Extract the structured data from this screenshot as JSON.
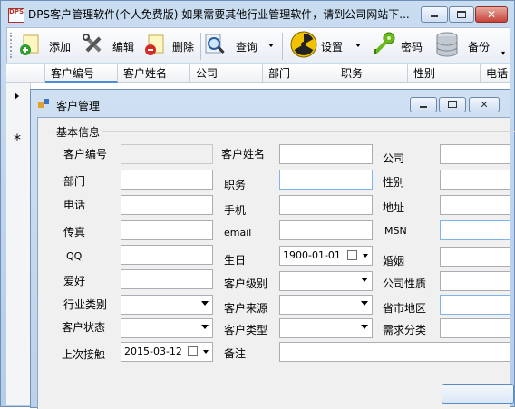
{
  "window": {
    "title": "DPS客户管理软件(个人免费版)   如果需要其他行业管理软件，请到公司网站下...",
    "icon_text": "DPS"
  },
  "toolbar": {
    "add": "添加",
    "edit": "编辑",
    "delete": "删除",
    "query": "查询",
    "settings": "设置",
    "password": "密码",
    "backup": "备份"
  },
  "grid": {
    "columns": [
      "客户编号",
      "客户姓名",
      "公司",
      "部门",
      "职务",
      "性别",
      "电话"
    ],
    "new_row_marker": "*"
  },
  "dialog": {
    "title": "客户管理",
    "group_title": "基本信息",
    "fields": {
      "customer_no": "客户编号",
      "customer_name": "客户姓名",
      "company": "公司",
      "department": "部门",
      "position": "职务",
      "gender": "性别",
      "phone": "电话",
      "mobile": "手机",
      "address": "地址",
      "fax": "传真",
      "email": "email",
      "msn": "MSN",
      "qq": "QQ",
      "birthday": "生日",
      "marriage": "婚姻",
      "hobby": "爱好",
      "customer_level": "客户级别",
      "company_nature": "公司性质",
      "industry": "行业类别",
      "customer_source": "客户来源",
      "region": "省市地区",
      "customer_status": "客户状态",
      "customer_type": "客户类型",
      "demand_category": "需求分类",
      "last_contact": "上次接触",
      "remark": "备注"
    },
    "values": {
      "birthday": "1900-01-01",
      "last_contact": "2015-03-12"
    }
  }
}
